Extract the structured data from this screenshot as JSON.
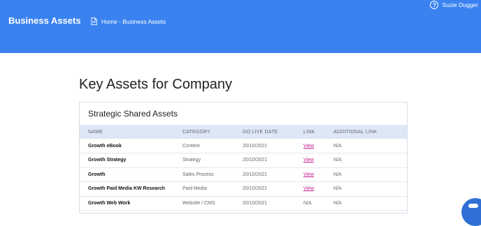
{
  "header": {
    "brand": "Business Assets",
    "breadcrumb": "Home - Business Assets",
    "user_name": "Suzie Dugger",
    "help_glyph": "?",
    "accent_color": "#3a82f0"
  },
  "main": {
    "title": "Key Assets for Company"
  },
  "assets_card": {
    "title": "Strategic Shared Assets",
    "columns": [
      "NAME",
      "CATEGORY",
      "GO LIVE DATE",
      "LINK",
      "ADDITIONAL LINK"
    ],
    "rows": [
      {
        "name": "Growth eBook",
        "category": "Content",
        "date": "20/10/2021",
        "link": "View",
        "link_clickable": true,
        "additional": "N/A"
      },
      {
        "name": "Growth Strategy",
        "category": "Strategy",
        "date": "20/10/2021",
        "link": "View",
        "link_clickable": true,
        "additional": "N/A"
      },
      {
        "name": "Growth",
        "category": "Sales Process",
        "date": "20/10/2021",
        "link": "View",
        "link_clickable": true,
        "additional": "N/A"
      },
      {
        "name": "Growth Paid Media KW Research",
        "category": "Paid Media",
        "date": "20/10/2021",
        "link": "View",
        "link_clickable": true,
        "additional": "N/A"
      },
      {
        "name": "Growth Web Work",
        "category": "Website / CMS",
        "date": "20/10/2021",
        "link": "N/A",
        "link_clickable": false,
        "additional": "N/A"
      }
    ],
    "link_color": "#c2188f"
  },
  "icons": {
    "breadcrumb": "document-icon",
    "help": "help-circle-icon",
    "chat": "chat-bubble-icon"
  }
}
